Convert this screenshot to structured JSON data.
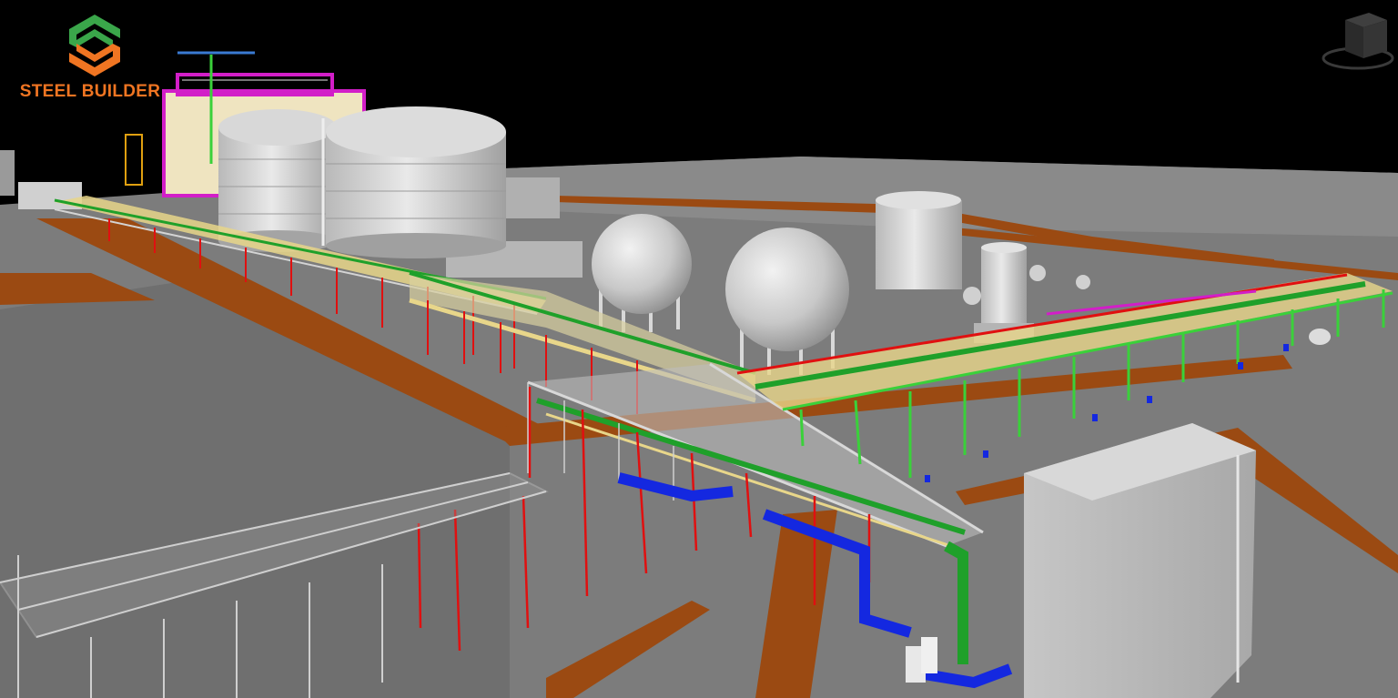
{
  "app": {
    "logo_text": "STEEL BUILDER"
  },
  "icons": {
    "logo": "steel-builder-s-logo",
    "view_cube": "view-cube-icon"
  },
  "colors": {
    "background": "#000000",
    "ground": "#7a7a7a",
    "road": "#9b4a12",
    "structure": "#d4d4d4",
    "pipe_green": "#1fa02a",
    "pipe_blue": "#1428e0",
    "pipe_yellow": "#e8d68a",
    "column_red": "#e01010",
    "accent_magenta": "#d21ec8",
    "logo_green": "#3aa64a",
    "logo_orange": "#f07522"
  }
}
